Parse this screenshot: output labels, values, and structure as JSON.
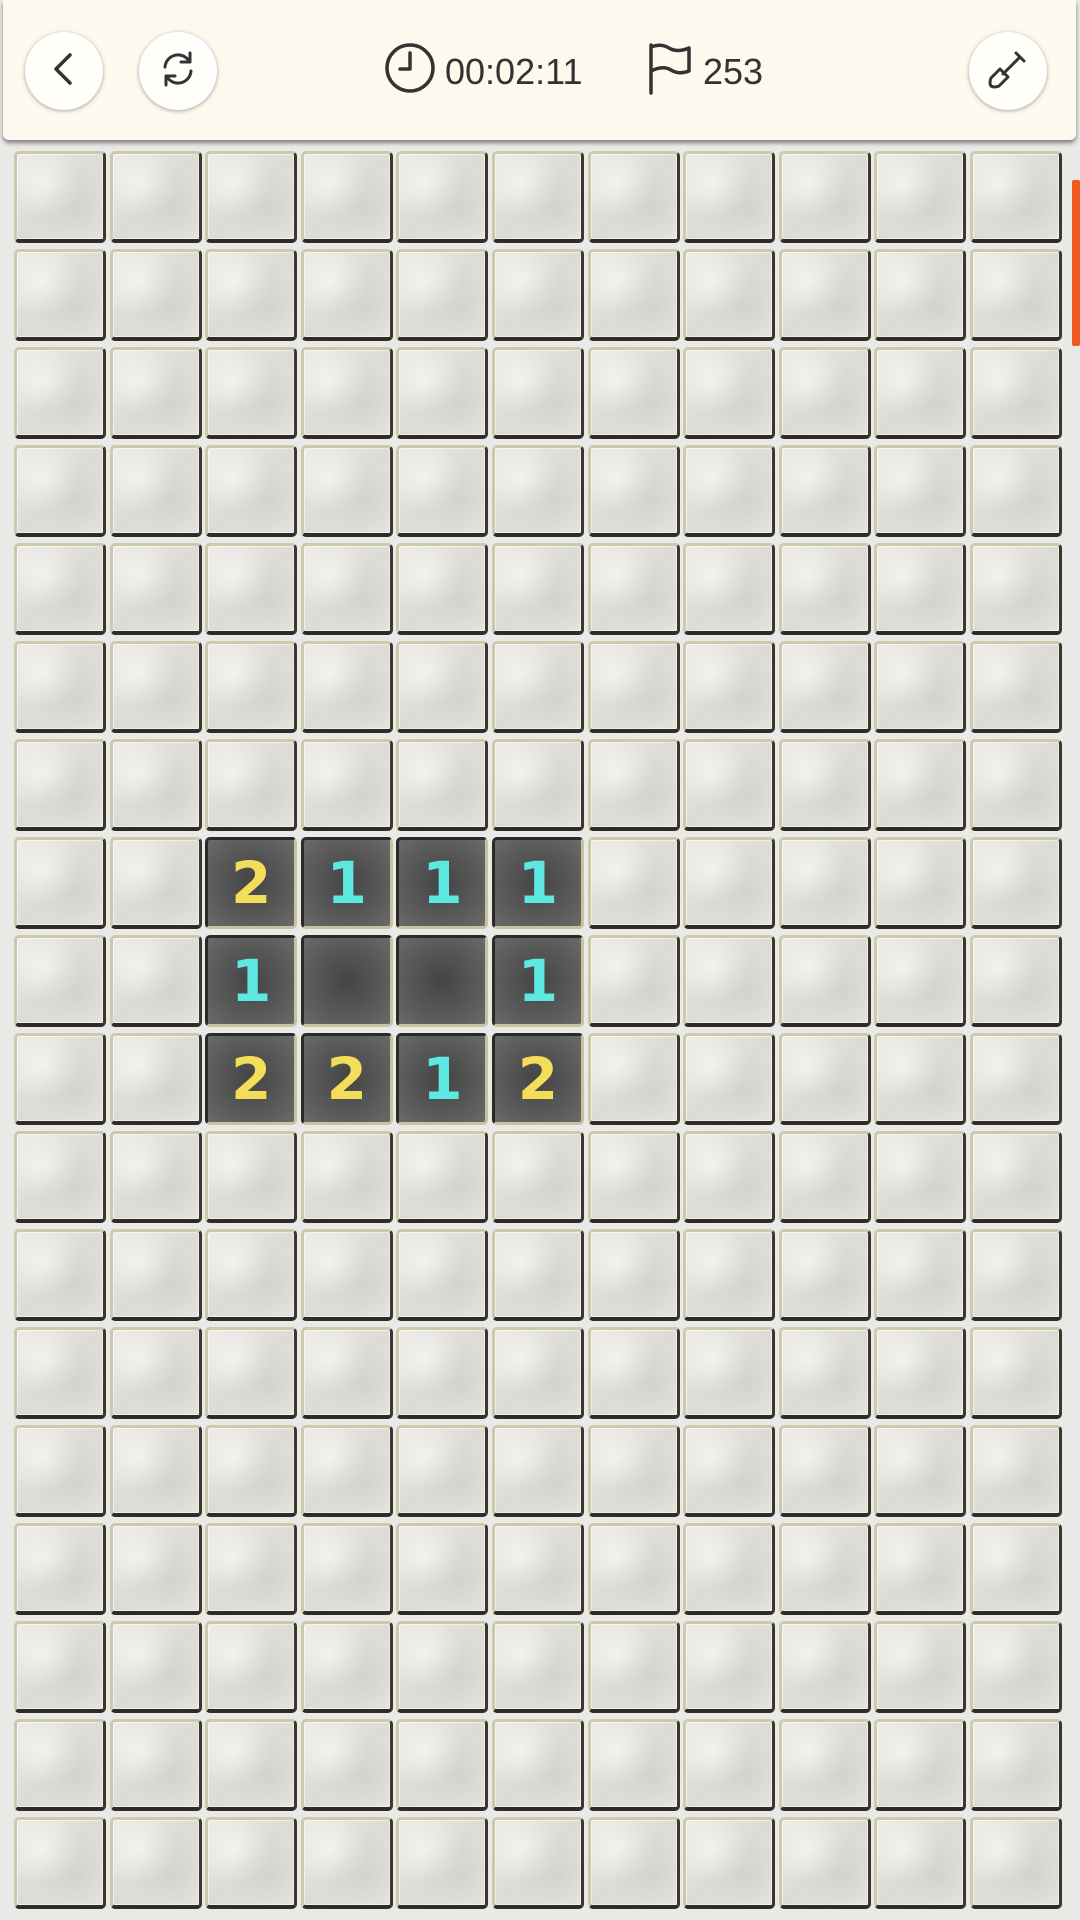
{
  "header": {
    "back_icon": "chevron-left-icon",
    "restart_icon": "refresh-icon",
    "timer_icon": "clock-icon",
    "timer": "00:02:11",
    "flags_icon": "flag-icon",
    "flags_remaining": "253",
    "mode_icon": "shovel-icon"
  },
  "board": {
    "columns": 11,
    "visible_rows": 18,
    "colors": {
      "number_1": "#5ee8e2",
      "number_2": "#f3de5a",
      "scroll_thumb": "#f15a1e"
    },
    "revealed": [
      {
        "row": 7,
        "col": 2,
        "value": "2"
      },
      {
        "row": 7,
        "col": 3,
        "value": "1"
      },
      {
        "row": 7,
        "col": 4,
        "value": "1"
      },
      {
        "row": 7,
        "col": 5,
        "value": "1"
      },
      {
        "row": 8,
        "col": 2,
        "value": "1"
      },
      {
        "row": 8,
        "col": 3,
        "value": ""
      },
      {
        "row": 8,
        "col": 4,
        "value": ""
      },
      {
        "row": 8,
        "col": 5,
        "value": "1"
      },
      {
        "row": 9,
        "col": 2,
        "value": "2"
      },
      {
        "row": 9,
        "col": 3,
        "value": "2"
      },
      {
        "row": 9,
        "col": 4,
        "value": "1"
      },
      {
        "row": 9,
        "col": 5,
        "value": "2"
      }
    ]
  }
}
